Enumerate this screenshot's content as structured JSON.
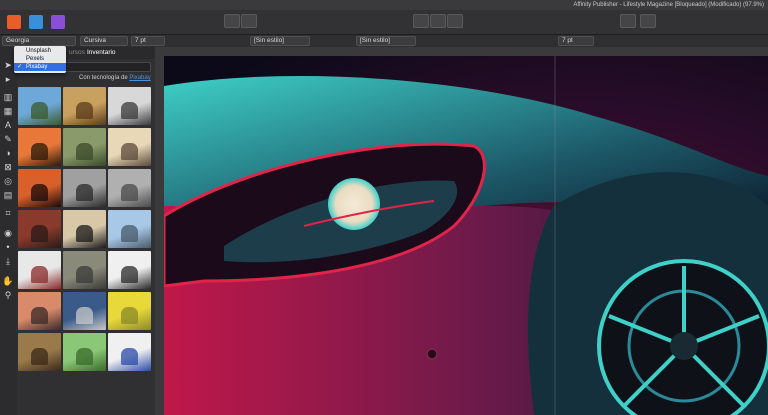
{
  "window": {
    "title": "Affinity Publisher - Lifestyle Magazine [Bloqueado] (Modificado) (97.9%)"
  },
  "toolbar": {
    "persona_icons": [
      "publisher-persona-icon",
      "photo-persona-icon",
      "designer-persona-icon"
    ],
    "persona_colors": [
      "#e85d2a",
      "#3a8fd8",
      "#8a4fd8"
    ]
  },
  "context_bar": {
    "font": "Georgia",
    "style": "Cursiva",
    "size": "7 pt",
    "char_style": "[Sin estilo]",
    "para_style": "[Sin estilo]",
    "leading": "7 pt"
  },
  "panel": {
    "tabs": [
      "ursos",
      "Inventario"
    ],
    "dropdown": {
      "options": [
        "Unsplash",
        "Pexels",
        "Pixabay"
      ],
      "selected": "Pixabay"
    },
    "powered_by_prefix": "Con tecnología de",
    "powered_by_link": "Pixabay",
    "thumb_count": 21
  },
  "colors": {
    "accent": "#2f6fe0",
    "link": "#4a90e2"
  }
}
